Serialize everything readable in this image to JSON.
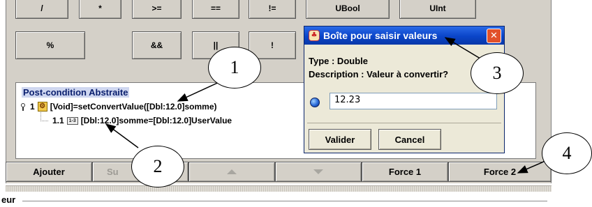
{
  "operators": {
    "row1": [
      "/",
      "*",
      ">=",
      "==",
      "!=",
      "UBool",
      "UInt"
    ],
    "row2": [
      "%",
      "&&",
      "||",
      "!"
    ]
  },
  "content": {
    "title": "Post-condition Abstraite",
    "tree": [
      {
        "number": "1",
        "text": "[Void]=setConvertValue([Dbl:12.0]somme)"
      },
      {
        "number": "1.1",
        "text": "[Dbl:12.0]somme=[Dbl:12.0]UserValue"
      }
    ]
  },
  "bottom_buttons": {
    "ajouter": "Ajouter",
    "supprimer": "Su",
    "force1": "Force 1",
    "force2": "Force 2"
  },
  "bottom_label": "eur",
  "dialog": {
    "title": "Boîte pour saisir valeurs",
    "close": "✕",
    "type_line": "Type : Double",
    "description_line": "Description : Valeur à convertir?",
    "value": "12.23",
    "valider": "Valider",
    "cancel": "Cancel"
  },
  "callouts": [
    "1",
    "2",
    "3",
    "4"
  ],
  "icons": {
    "pin": "pin-icon",
    "gear": "gear-icon",
    "sequence": "sequence-icon",
    "globe": "globe-icon",
    "app": "app-icon"
  },
  "colors": {
    "panel": "#d4d0c8",
    "title_bar": "#0a44c8",
    "close": "#e2512a",
    "content_title": "#0a1f6e"
  }
}
